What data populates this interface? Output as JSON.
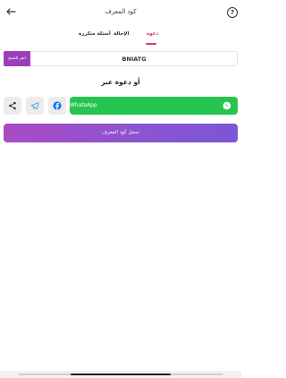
{
  "header": {
    "title": "كود المعرف",
    "help_label": "?"
  },
  "tabs": [
    {
      "label": "دعوة",
      "active": true
    },
    {
      "label": "الإحالة",
      "active": false
    },
    {
      "label": "أسئلة متكررة",
      "active": false
    }
  ],
  "referral": {
    "code": "BNIATG",
    "copy_label": "انقر للنسخ"
  },
  "invite": {
    "heading": "أو دعوة عبر",
    "whatsapp_label": "WhatsApp"
  },
  "register_label": "سجل كود المعرف",
  "colors": {
    "accent": "#e03a6c",
    "purple": "#9b3fb8",
    "whatsapp": "#26c54f"
  }
}
